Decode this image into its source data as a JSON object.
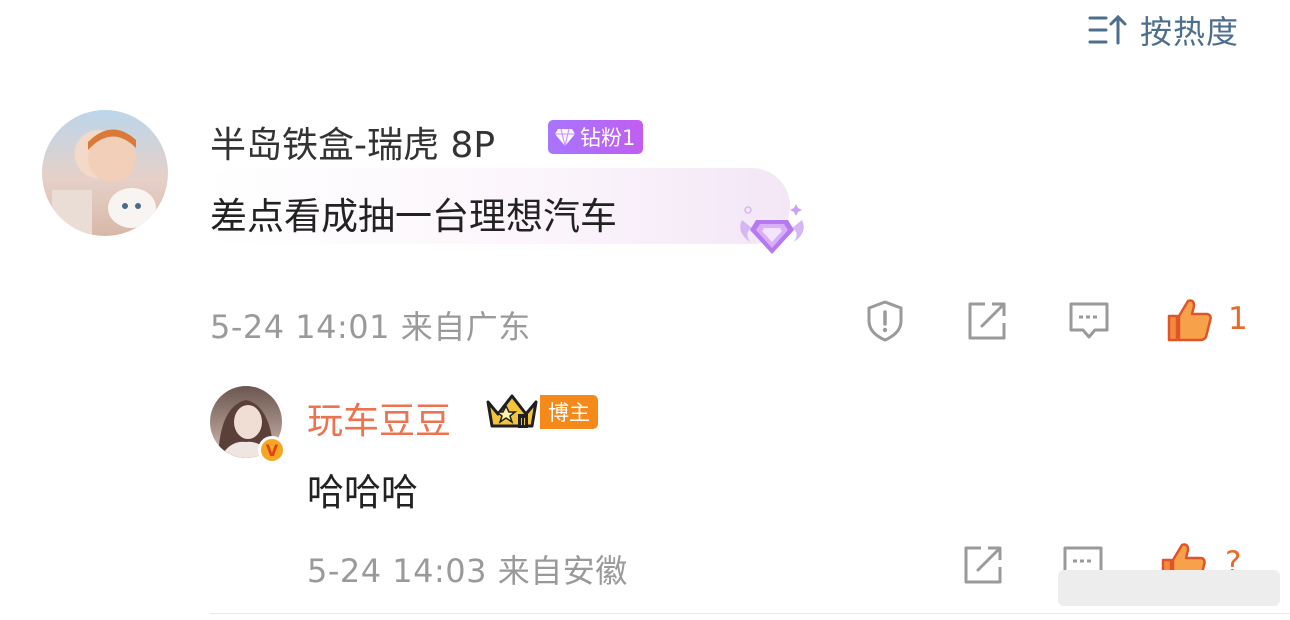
{
  "sort": {
    "label": "按热度",
    "icon": "sort-lines-icon",
    "color": "#4e6e8e"
  },
  "comment": {
    "username": "半岛铁盒-瑞虎 8P",
    "badge": "钻粉1",
    "text": "差点看成抽一台理想汽车",
    "meta": "5-24 14:01 来自广东",
    "like_count": "1",
    "actions": [
      "report-icon",
      "share-icon",
      "reply-icon",
      "thumbs-up-icon"
    ]
  },
  "reply": {
    "username": "玩车豆豆",
    "badge": "博主",
    "verified": "V",
    "text": "哈哈哈",
    "meta": "5-24 14:03 来自安徽",
    "like_count": "?",
    "actions": [
      "share-icon",
      "reply-icon",
      "thumbs-up-icon"
    ]
  },
  "colors": {
    "username": "#333333",
    "blogger_name": "#eb7350",
    "like": "#e86a2b",
    "meta": "#9a9a9a",
    "diamond_badge": "#b36af5",
    "blogger_badge": "#f58a1b"
  }
}
